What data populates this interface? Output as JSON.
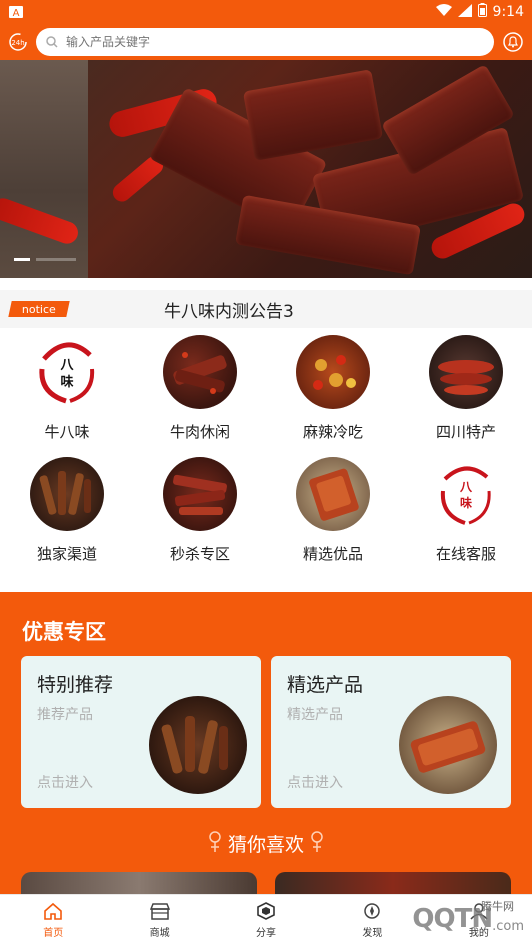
{
  "status_bar": {
    "time": "9:14",
    "notification_letter": "A"
  },
  "search": {
    "placeholder": "输入产品关键字"
  },
  "notice": {
    "tag": "notice",
    "text": "牛八味内测公告3"
  },
  "categories": [
    {
      "label": "牛八味",
      "icon": "niubawei-logo-icon"
    },
    {
      "label": "牛肉休闲",
      "icon": "beef-jerky-icon"
    },
    {
      "label": "麻辣冷吃",
      "icon": "spicy-cold-icon"
    },
    {
      "label": "四川特产",
      "icon": "sichuan-sausage-icon"
    },
    {
      "label": "独家渠道",
      "icon": "exclusive-channel-icon"
    },
    {
      "label": "秒杀专区",
      "icon": "flash-sale-icon"
    },
    {
      "label": "精选优品",
      "icon": "selected-product-icon"
    },
    {
      "label": "在线客服",
      "icon": "customer-service-logo-icon"
    }
  ],
  "promo": {
    "title": "优惠专区",
    "cards": [
      {
        "title": "特别推荐",
        "subtitle": "推荐产品",
        "enter": "点击进入"
      },
      {
        "title": "精选产品",
        "subtitle": "精选产品",
        "enter": "点击进入"
      }
    ]
  },
  "guess": {
    "title": "猜你喜欢"
  },
  "nav": [
    {
      "label": "首页",
      "icon": "home-icon",
      "active": true
    },
    {
      "label": "商城",
      "icon": "store-icon",
      "active": false
    },
    {
      "label": "分享",
      "icon": "share-icon",
      "active": false
    },
    {
      "label": "发现",
      "icon": "discover-icon",
      "active": false
    },
    {
      "label": "我的",
      "icon": "profile-icon",
      "active": false
    }
  ],
  "watermark": {
    "main": "QQTN",
    "sub": "腾牛网",
    "suffix": ".com"
  },
  "colors": {
    "brand": "#f35a0c",
    "card_bg": "#e9f5f4",
    "nav_active": "#f35a0c"
  }
}
